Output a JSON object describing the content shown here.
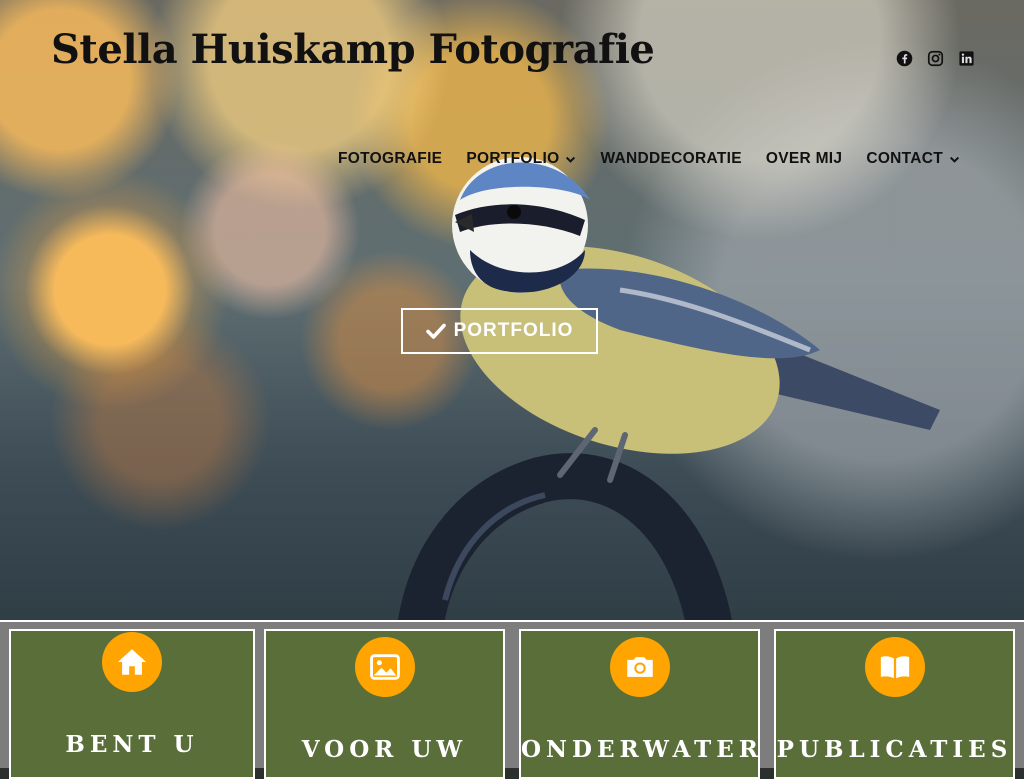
{
  "site": {
    "title": "Stella Huiskamp Fotografie"
  },
  "social": [
    {
      "name": "facebook-icon"
    },
    {
      "name": "instagram-icon"
    },
    {
      "name": "linkedin-icon"
    }
  ],
  "nav": {
    "items": [
      {
        "label": "FOTOGRAFIE",
        "dropdown": false
      },
      {
        "label": "PORTFOLIO",
        "dropdown": true
      },
      {
        "label": "WANDDECORATIE",
        "dropdown": false
      },
      {
        "label": "OVER MIJ",
        "dropdown": false
      },
      {
        "label": "CONTACT",
        "dropdown": true
      }
    ]
  },
  "hero": {
    "button_label": "PORTFOLIO",
    "button_icon": "check-icon"
  },
  "cards": [
    {
      "icon": "home-icon",
      "title": "BENT U"
    },
    {
      "icon": "image-icon",
      "title": "VOOR UW"
    },
    {
      "icon": "camera-icon",
      "title": "ONDERWATER"
    },
    {
      "icon": "book-icon",
      "title": "PUBLICATIES"
    }
  ],
  "colors": {
    "card_bg": "#5a6e3a",
    "icon_circle": "#ffa400",
    "title_text": "#111111"
  }
}
